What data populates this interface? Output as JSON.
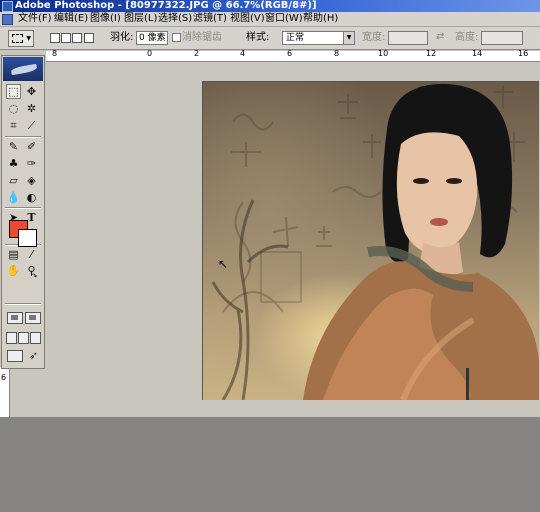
{
  "window": {
    "title": "Adobe Photoshop - [80977322.JPG @ 66.7%(RGB/8#)]"
  },
  "menu": {
    "items": [
      {
        "label": "文件(F)"
      },
      {
        "label": "编辑(E)"
      },
      {
        "label": "图像(I)"
      },
      {
        "label": "图层(L)"
      },
      {
        "label": "选择(S)"
      },
      {
        "label": "滤镜(T)"
      },
      {
        "label": "视图(V)"
      },
      {
        "label": "窗口(W)"
      },
      {
        "label": "帮助(H)"
      }
    ]
  },
  "options": {
    "feather_label": "羽化:",
    "feather_value": "0 像素",
    "antialias_label": "消除锯齿",
    "style_label": "样式:",
    "style_value": "正常",
    "width_label": "宽度:",
    "height_label": "高度:"
  },
  "ruler_top": {
    "numbers": [
      "8",
      "0",
      "2",
      "4",
      "6",
      "8",
      "10",
      "12",
      "14",
      "16"
    ]
  },
  "ruler_left": {
    "numbers": [
      "6"
    ]
  },
  "colors": {
    "foreground": "#f04a30",
    "background": "#ffffff",
    "title_bar": "#0a2a8c",
    "chrome": "#d6d3ce",
    "workspace": "#868583"
  },
  "tools": [
    "marquee-icon",
    "move-icon",
    "lasso-icon",
    "magic-wand-icon",
    "crop-icon",
    "slice-icon",
    "healing-brush-icon",
    "brush-icon",
    "clone-stamp-icon",
    "history-brush-icon",
    "eraser-icon",
    "paint-bucket-icon",
    "blur-icon",
    "dodge-icon",
    "path-selection-icon",
    "type-icon",
    "pen-icon",
    "shape-icon",
    "notes-icon",
    "eyedropper-icon",
    "hand-icon",
    "zoom-icon"
  ]
}
